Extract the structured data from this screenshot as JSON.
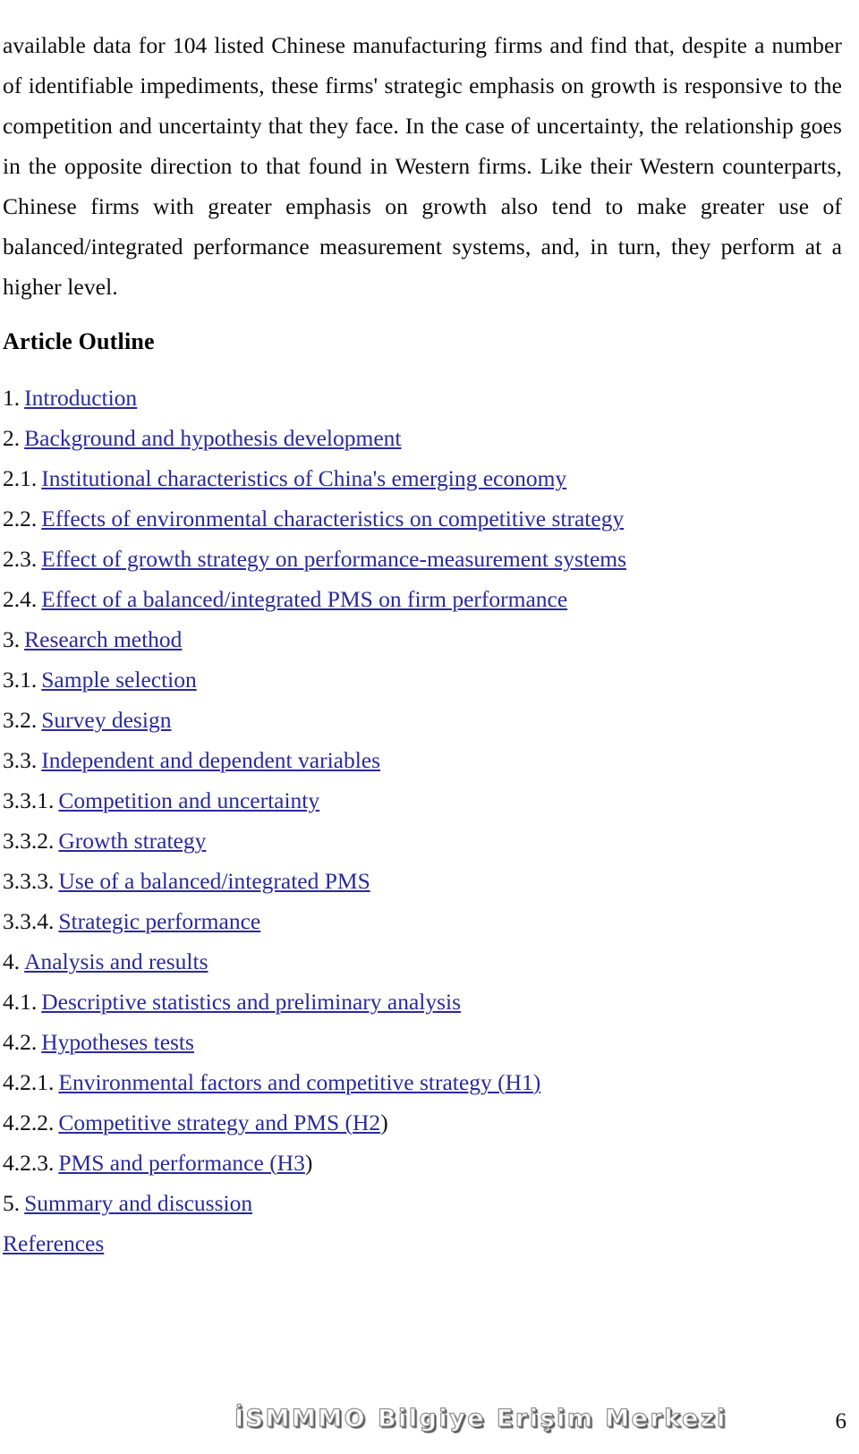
{
  "document": {
    "abstract_paragraph": "available data for 104 listed Chinese manufacturing firms and find that, despite a number of identifiable impediments, these firms' strategic emphasis on growth is responsive to the competition and uncertainty that they face. In the case of uncertainty, the relationship goes in the opposite direction to that found in Western firms. Like their Western counterparts, Chinese firms with greater emphasis on growth also tend to make greater use of balanced/integrated performance measurement systems, and, in turn, they perform at a higher level.",
    "section_heading": "Article Outline",
    "outline": [
      {
        "number": "1.",
        "label": "Introduction",
        "tail": ""
      },
      {
        "number": "2.",
        "label": "Background and hypothesis development",
        "tail": ""
      },
      {
        "number": "2.1.",
        "label": "Institutional characteristics of China's emerging economy",
        "tail": ""
      },
      {
        "number": "2.2.",
        "label": "Effects of environmental characteristics on competitive strategy",
        "tail": ""
      },
      {
        "number": "2.3.",
        "label": "Effect of growth strategy on performance-measurement systems",
        "tail": ""
      },
      {
        "number": "2.4.",
        "label": "Effect of a balanced/integrated PMS on firm performance",
        "tail": ""
      },
      {
        "number": "3.",
        "label": "Research method",
        "tail": ""
      },
      {
        "number": "3.1.",
        "label": "Sample selection",
        "tail": ""
      },
      {
        "number": "3.2.",
        "label": "Survey design",
        "tail": ""
      },
      {
        "number": "3.3.",
        "label": "Independent and dependent variables",
        "tail": ""
      },
      {
        "number": "3.3.1.",
        "label": "Competition and uncertainty",
        "tail": ""
      },
      {
        "number": "3.3.2.",
        "label": "Growth strategy",
        "tail": ""
      },
      {
        "number": "3.3.3.",
        "label": "Use of a balanced/integrated PMS",
        "tail": ""
      },
      {
        "number": "3.3.4.",
        "label": "Strategic performance",
        "tail": ""
      },
      {
        "number": "4.",
        "label": "Analysis and results",
        "tail": ""
      },
      {
        "number": "4.1.",
        "label": "Descriptive statistics and preliminary analysis",
        "tail": ""
      },
      {
        "number": "4.2.",
        "label": "Hypotheses tests",
        "tail": ""
      },
      {
        "number": "4.2.1.",
        "label": "Environmental factors and competitive strategy (H1)",
        "tail": ""
      },
      {
        "number": "4.2.2.",
        "label": "Competitive strategy and PMS (H2",
        "tail": ")"
      },
      {
        "number": "4.2.3.",
        "label": "PMS and performance (H3",
        "tail": ")"
      },
      {
        "number": "5.",
        "label": "Summary and discussion",
        "tail": ""
      },
      {
        "number": "",
        "label": "References",
        "tail": ""
      }
    ],
    "watermark": "İSMMMO Bilgiye Erişim Merkezi",
    "page_number": "6",
    "colors": {
      "link": "#2a2a9c",
      "text": "#101010",
      "background": "#ffffff",
      "watermark_outline": "#8a8a8a"
    }
  }
}
